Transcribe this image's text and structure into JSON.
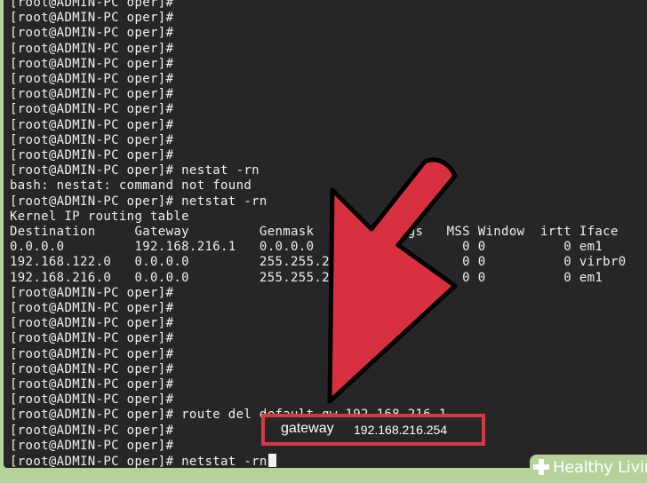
{
  "prompt": "[root@ADMIN-PC oper]#",
  "terminal": {
    "lines": [
      "[root@ADMIN-PC oper]#",
      "[root@ADMIN-PC oper]#",
      "[root@ADMIN-PC oper]#",
      "[root@ADMIN-PC oper]#",
      "[root@ADMIN-PC oper]#",
      "[root@ADMIN-PC oper]#",
      "[root@ADMIN-PC oper]#",
      "[root@ADMIN-PC oper]#",
      "[root@ADMIN-PC oper]#",
      "[root@ADMIN-PC oper]#",
      "[root@ADMIN-PC oper]#",
      "[root@ADMIN-PC oper]# nestat -rn",
      "bash: nestat: command not found",
      "[root@ADMIN-PC oper]# netstat -rn",
      "Kernel IP routing table",
      "Destination     Gateway         Genmask         Flags   MSS Window  irtt Iface",
      "0.0.0.0         192.168.216.1   0.0.0.0         UG        0 0          0 em1",
      "192.168.122.0   0.0.0.0         255.255.255.0   U         0 0          0 virbr0",
      "192.168.216.0   0.0.0.0         255.255.255.0   U         0 0          0 em1",
      "[root@ADMIN-PC oper]#",
      "[root@ADMIN-PC oper]#",
      "[root@ADMIN-PC oper]#",
      "[root@ADMIN-PC oper]#",
      "[root@ADMIN-PC oper]#",
      "[root@ADMIN-PC oper]#",
      "[root@ADMIN-PC oper]#",
      "[root@ADMIN-PC oper]#",
      "[root@ADMIN-PC oper]# route del default gw 192.168.216.1",
      "[root@ADMIN-PC oper]#",
      "[root@ADMIN-PC oper]#",
      "[root@ADMIN-PC oper]# netstat -rn"
    ]
  },
  "callout": {
    "label": "gateway",
    "value": "192.168.216.254"
  },
  "brand": {
    "name": "Healthy Living",
    "icon": "plus-icon"
  },
  "colors": {
    "terminal_bg": "#262626",
    "terminal_text": "#f0f0f0",
    "arrow": "#d9303f",
    "highlight_border": "#d43a44",
    "frame": "#b4d29a"
  }
}
